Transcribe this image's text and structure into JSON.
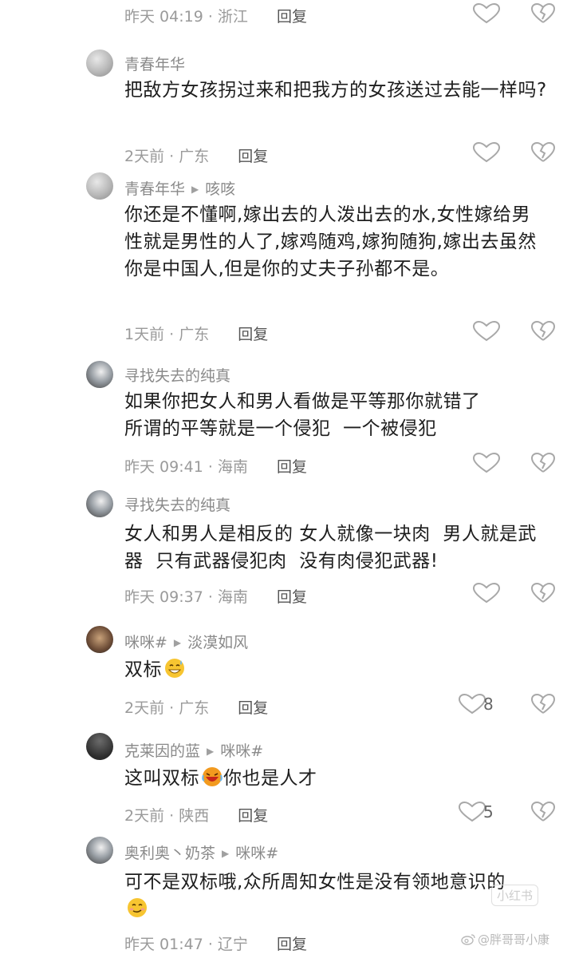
{
  "comments": [
    {
      "id": "c0",
      "name": "",
      "reply_to": "",
      "text": "",
      "time": "昨天 04:19",
      "location": "浙江",
      "reply_label": "回复",
      "likes": ""
    },
    {
      "id": "c1",
      "name": "青春年华",
      "reply_to": "",
      "text": "把敌方女孩拐过来和把我方的女孩送过去能一样吗?",
      "time": "2天前",
      "location": "广东",
      "reply_label": "回复",
      "likes": ""
    },
    {
      "id": "c2",
      "name": "青春年华",
      "reply_to": "咳咳",
      "text": "你还是不懂啊,嫁出去的人泼出去的水,女性嫁给男性就是男性的人了,嫁鸡随鸡,嫁狗随狗,嫁出去虽然你是中国人,但是你的丈夫子孙都不是。",
      "time": "1天前",
      "location": "广东",
      "reply_label": "回复",
      "likes": ""
    },
    {
      "id": "c3",
      "name": "寻找失去的纯真",
      "reply_to": "",
      "text_lines": [
        "如果你把女人和男人看做是平等那你就错了",
        "所谓的平等就是一个侵犯  一个被侵犯"
      ],
      "time": "昨天 09:41",
      "location": "海南",
      "reply_label": "回复",
      "likes": ""
    },
    {
      "id": "c4",
      "name": "寻找失去的纯真",
      "reply_to": "",
      "text": "女人和男人是相反的 女人就像一块肉  男人就是武器  只有武器侵犯肉  没有肉侵犯武器!",
      "time": "昨天 09:37",
      "location": "海南",
      "reply_label": "回复",
      "likes": ""
    },
    {
      "id": "c5",
      "name": "咪咪#",
      "reply_to": "淡漠如风",
      "text": "双标",
      "emoji": "grin-sweat-emoji",
      "time": "2天前",
      "location": "广东",
      "reply_label": "回复",
      "likes": "8"
    },
    {
      "id": "c6",
      "name": "克莱因的蓝",
      "reply_to": "咪咪#",
      "text_before": "这叫双标",
      "emoji": "laugh-tears-emoji",
      "text_after": "你也是人才",
      "time": "2天前",
      "location": "陕西",
      "reply_label": "回复",
      "likes": "5"
    },
    {
      "id": "c7",
      "name": "奥利奥丶奶茶",
      "reply_to": "咪咪#",
      "text": "可不是双标哦,众所周知女性是没有领地意识的",
      "emoji": "smirk-emoji",
      "time": "昨天 01:47",
      "location": "辽宁",
      "reply_label": "回复",
      "likes": ""
    }
  ],
  "watermarks": {
    "xiaohongshu": "小红书",
    "weibo": "@胖哥哥小康"
  },
  "colors": {
    "meta": "#9a9a9a",
    "name": "#8a8a8a",
    "text": "#1e1e1e",
    "icon": "#a8a8a8"
  }
}
